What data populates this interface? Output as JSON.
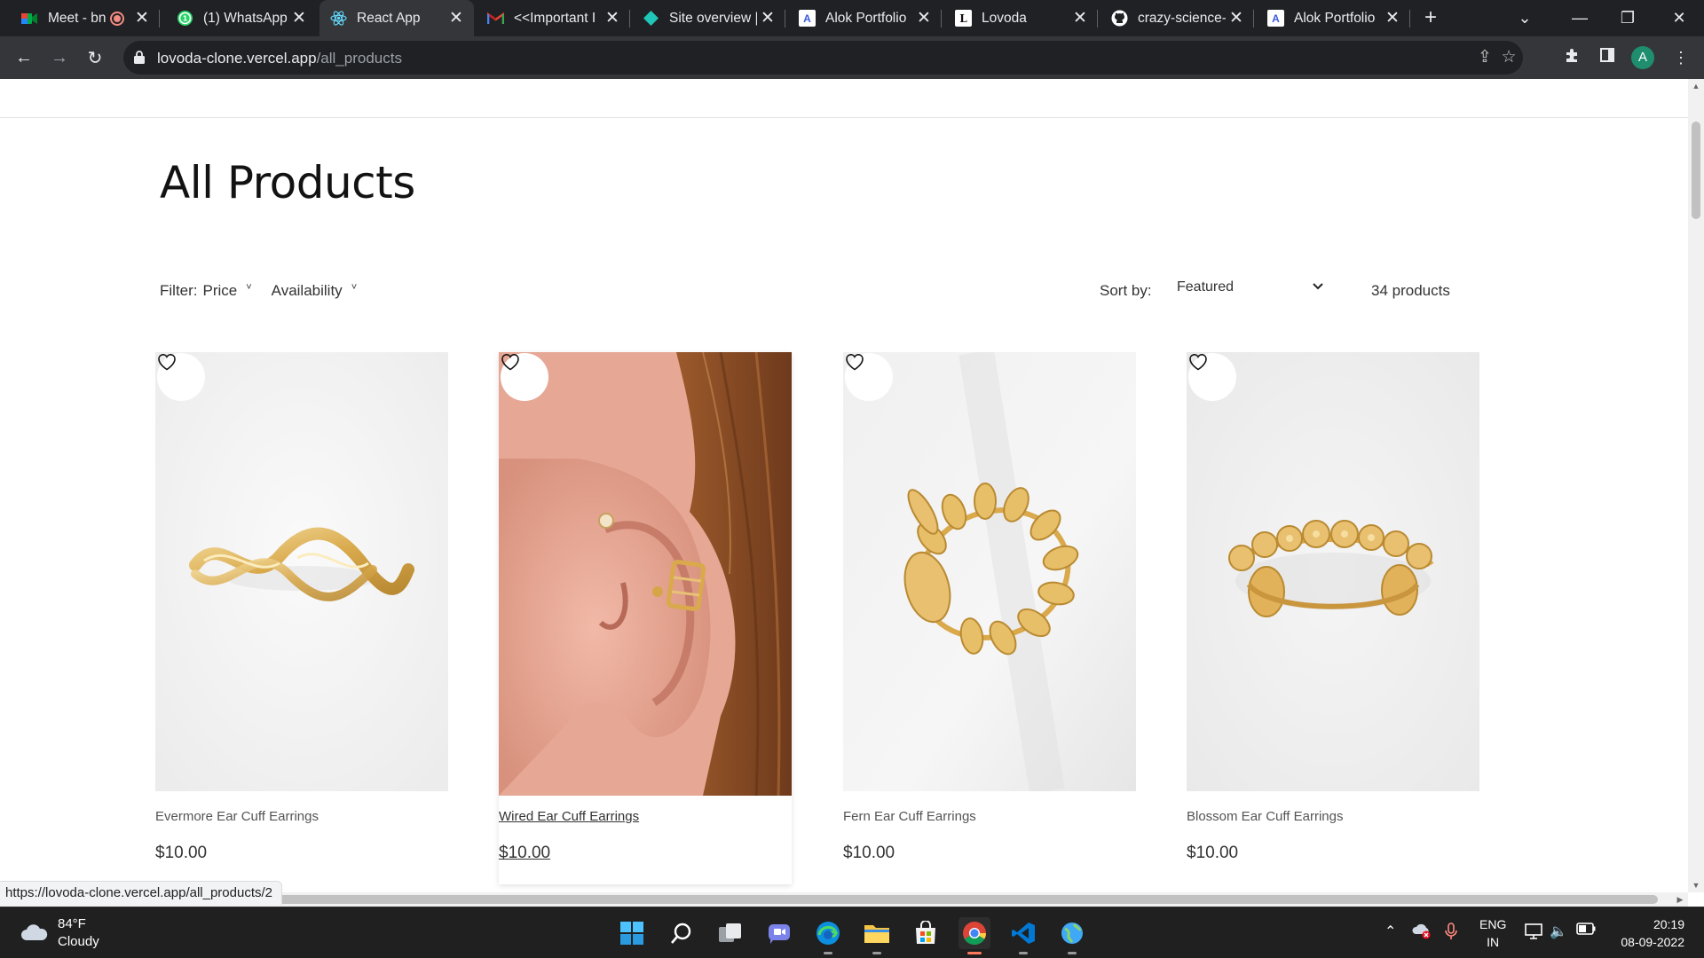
{
  "browser": {
    "tabs": [
      {
        "title": "Meet - bn",
        "icon": "meet-icon",
        "recording": true
      },
      {
        "title": "(1) WhatsApp",
        "icon": "whatsapp-icon"
      },
      {
        "title": "React App",
        "icon": "react-icon",
        "active": true
      },
      {
        "title": "<<Important I",
        "icon": "gmail-icon"
      },
      {
        "title": "Site overview |",
        "icon": "netlify-icon"
      },
      {
        "title": "Alok Portfolio",
        "icon": "portfolio-icon"
      },
      {
        "title": "Lovoda",
        "icon": "lovoda-icon"
      },
      {
        "title": "crazy-science-",
        "icon": "github-icon"
      },
      {
        "title": "Alok Portfolio",
        "icon": "portfolio-icon"
      }
    ],
    "url_host": "lovoda-clone.vercel.app",
    "url_path": "/all_products",
    "profile_initial": "A",
    "status_url": "https://lovoda-clone.vercel.app/all_products/2"
  },
  "page": {
    "title": "All Products",
    "filter_label": "Filter:",
    "filters": [
      "Price",
      "Availability"
    ],
    "sort_label": "Sort by:",
    "sort_value": "Featured",
    "product_count": "34 products",
    "products": [
      {
        "name": "Evermore Ear Cuff Earrings",
        "price": "$10.00"
      },
      {
        "name": "Wired Ear Cuff Earrings",
        "price": "$10.00",
        "hovered": true
      },
      {
        "name": "Fern Ear Cuff Earrings",
        "price": "$10.00"
      },
      {
        "name": "Blossom Ear Cuff Earrings",
        "price": "$10.00"
      }
    ]
  },
  "taskbar": {
    "weather_temp": "84°F",
    "weather_condition": "Cloudy",
    "language_top": "ENG",
    "language_bottom": "IN",
    "time": "20:19",
    "date": "08-09-2022"
  },
  "colors": {
    "chrome_dark": "#202124",
    "toolbar": "#35363a",
    "gold": "#d9b15c",
    "accent_active": "#ff7a5c"
  }
}
